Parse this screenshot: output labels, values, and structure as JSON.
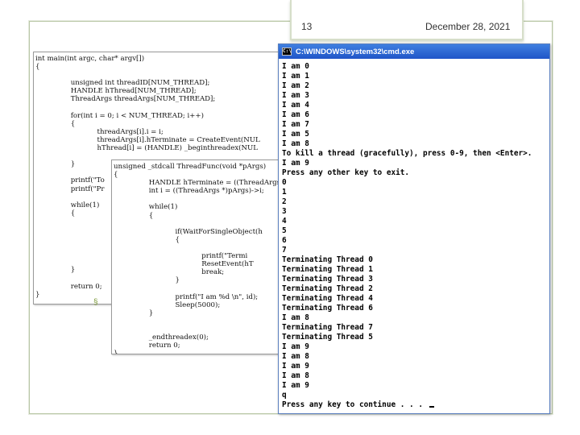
{
  "slide": {
    "number": "13",
    "date": "December 28, 2021",
    "bullet": "§"
  },
  "code_main": {
    "lines": [
      "int main(int argc, char* argv[])",
      "{",
      "",
      "                unsigned int threadID[NUM_THREAD];",
      "                HANDLE hThread[NUM_THREAD];",
      "                ThreadArgs threadArgs[NUM_THREAD];",
      "",
      "                for(int i = 0; i < NUM_THREAD; i++)",
      "                {",
      "                            threadArgs[i].i = i;",
      "                            threadArgs[i].hTerminate = CreateEvent(NUL",
      "                            hThread[i] = (HANDLE) _beginthreadex(NUL",
      "",
      "                }",
      "",
      "                printf(\"To",
      "                printf(\"Pr",
      "",
      "                while(1)",
      "                {",
      "",
      "",
      "",
      "",
      "",
      "",
      "                }",
      "",
      "                return 0;",
      "}"
    ]
  },
  "code_thread": {
    "lines": [
      "unsigned _stdcall ThreadFunc(void *pArgs)",
      "{",
      "                HANDLE hTerminate = ((ThreadArgs",
      "                int i = ((ThreadArgs *)pArgs)->i;",
      "",
      "                while(1)",
      "                {",
      "",
      "                            if(WaitForSingleObject(h",
      "                            {",
      "",
      "                                        printf(\"Termi",
      "                                        ResetEvent(hT",
      "                                        break;",
      "                            }",
      "",
      "                            printf(\"I am %d \\n\", id);",
      "                            Sleep(5000);",
      "                }",
      "",
      "",
      "                _endthreadex(0);",
      "                return 0;",
      "}"
    ]
  },
  "cmd": {
    "title": "C:\\WINDOWS\\system32\\cmd.exe",
    "icon_label": "C:\\",
    "lines": [
      "I am 0",
      "I am 1",
      "I am 2",
      "I am 3",
      "I am 4",
      "I am 6",
      "I am 7",
      "I am 5",
      "I am 8",
      "To kill a thread (gracefully), press 0-9, then <Enter>.",
      "I am 9",
      "Press any other key to exit.",
      "0",
      "1",
      "2",
      "3",
      "4",
      "5",
      "6",
      "7",
      "Terminating Thread 0",
      "Terminating Thread 1",
      "Terminating Thread 3",
      "Terminating Thread 2",
      "Terminating Thread 4",
      "Terminating Thread 6",
      "I am 8",
      "Terminating Thread 7",
      "Terminating Thread 5",
      "I am 9",
      "I am 8",
      "I am 9",
      "I am 8",
      "I am 9",
      "q",
      "Press any key to continue . . . "
    ]
  }
}
